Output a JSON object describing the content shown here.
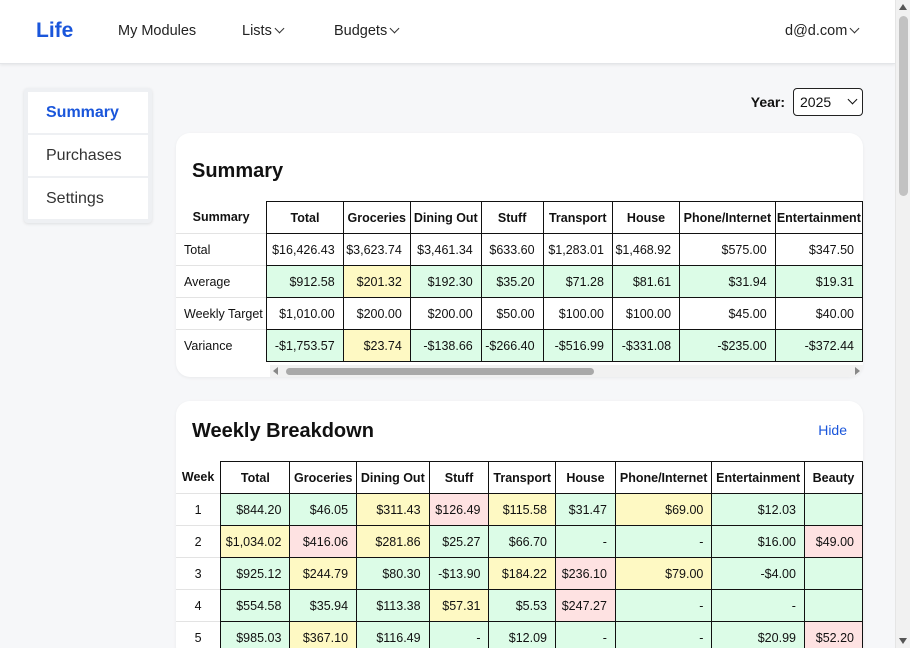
{
  "nav": {
    "brand": "Life",
    "items": [
      {
        "label": "My Modules",
        "dropdown": false
      },
      {
        "label": "Lists",
        "dropdown": true
      },
      {
        "label": "Budgets",
        "dropdown": true
      }
    ],
    "user": "d@d.com"
  },
  "sidebar": {
    "items": [
      {
        "label": "Summary",
        "active": true
      },
      {
        "label": "Purchases",
        "active": false
      },
      {
        "label": "Settings",
        "active": false
      }
    ]
  },
  "year": {
    "label": "Year:",
    "value": "2025"
  },
  "summary": {
    "title": "Summary",
    "corner": "Summary",
    "columns": [
      "Total",
      "Groceries",
      "Dining Out",
      "Stuff",
      "Transport",
      "House",
      "Phone/Internet",
      "Entertainment"
    ],
    "rows": [
      {
        "label": "Total",
        "cells": [
          {
            "v": "$16,426.43",
            "c": "w"
          },
          {
            "v": "$3,623.74",
            "c": "w"
          },
          {
            "v": "$3,461.34",
            "c": "w"
          },
          {
            "v": "$633.60",
            "c": "w"
          },
          {
            "v": "$1,283.01",
            "c": "w"
          },
          {
            "v": "$1,468.92",
            "c": "w"
          },
          {
            "v": "$575.00",
            "c": "w"
          },
          {
            "v": "$347.50",
            "c": "w"
          }
        ]
      },
      {
        "label": "Average",
        "cells": [
          {
            "v": "$912.58",
            "c": "g"
          },
          {
            "v": "$201.32",
            "c": "y"
          },
          {
            "v": "$192.30",
            "c": "g"
          },
          {
            "v": "$35.20",
            "c": "g"
          },
          {
            "v": "$71.28",
            "c": "g"
          },
          {
            "v": "$81.61",
            "c": "g"
          },
          {
            "v": "$31.94",
            "c": "g"
          },
          {
            "v": "$19.31",
            "c": "g"
          }
        ]
      },
      {
        "label": "Weekly Target",
        "cells": [
          {
            "v": "$1,010.00",
            "c": "w"
          },
          {
            "v": "$200.00",
            "c": "w"
          },
          {
            "v": "$200.00",
            "c": "w"
          },
          {
            "v": "$50.00",
            "c": "w"
          },
          {
            "v": "$100.00",
            "c": "w"
          },
          {
            "v": "$100.00",
            "c": "w"
          },
          {
            "v": "$45.00",
            "c": "w"
          },
          {
            "v": "$40.00",
            "c": "w"
          }
        ]
      },
      {
        "label": "Variance",
        "cells": [
          {
            "v": "-$1,753.57",
            "c": "g"
          },
          {
            "v": "$23.74",
            "c": "y"
          },
          {
            "v": "-$138.66",
            "c": "g"
          },
          {
            "v": "-$266.40",
            "c": "g"
          },
          {
            "v": "-$516.99",
            "c": "g"
          },
          {
            "v": "-$331.08",
            "c": "g"
          },
          {
            "v": "-$235.00",
            "c": "g"
          },
          {
            "v": "-$372.44",
            "c": "g"
          }
        ]
      }
    ]
  },
  "weekly": {
    "title": "Weekly Breakdown",
    "hide_label": "Hide",
    "corner": "Week",
    "columns": [
      "Total",
      "Groceries",
      "Dining Out",
      "Stuff",
      "Transport",
      "House",
      "Phone/Internet",
      "Entertainment",
      "Beauty"
    ],
    "rows": [
      {
        "label": "1",
        "cells": [
          {
            "v": "$844.20",
            "c": "g"
          },
          {
            "v": "$46.05",
            "c": "g"
          },
          {
            "v": "$311.43",
            "c": "y"
          },
          {
            "v": "$126.49",
            "c": "r"
          },
          {
            "v": "$115.58",
            "c": "y"
          },
          {
            "v": "$31.47",
            "c": "g"
          },
          {
            "v": "$69.00",
            "c": "y"
          },
          {
            "v": "$12.03",
            "c": "g"
          },
          {
            "v": "",
            "c": "g"
          }
        ]
      },
      {
        "label": "2",
        "cells": [
          {
            "v": "$1,034.02",
            "c": "y"
          },
          {
            "v": "$416.06",
            "c": "r"
          },
          {
            "v": "$281.86",
            "c": "y"
          },
          {
            "v": "$25.27",
            "c": "g"
          },
          {
            "v": "$66.70",
            "c": "g"
          },
          {
            "v": "-",
            "c": "g"
          },
          {
            "v": "-",
            "c": "g"
          },
          {
            "v": "$16.00",
            "c": "g"
          },
          {
            "v": "$49.00",
            "c": "r"
          }
        ]
      },
      {
        "label": "3",
        "cells": [
          {
            "v": "$925.12",
            "c": "g"
          },
          {
            "v": "$244.79",
            "c": "y"
          },
          {
            "v": "$80.30",
            "c": "g"
          },
          {
            "v": "-$13.90",
            "c": "g"
          },
          {
            "v": "$184.22",
            "c": "y"
          },
          {
            "v": "$236.10",
            "c": "r"
          },
          {
            "v": "$79.00",
            "c": "y"
          },
          {
            "v": "-$4.00",
            "c": "g"
          },
          {
            "v": "",
            "c": "g"
          }
        ]
      },
      {
        "label": "4",
        "cells": [
          {
            "v": "$554.58",
            "c": "g"
          },
          {
            "v": "$35.94",
            "c": "g"
          },
          {
            "v": "$113.38",
            "c": "g"
          },
          {
            "v": "$57.31",
            "c": "y"
          },
          {
            "v": "$5.53",
            "c": "g"
          },
          {
            "v": "$247.27",
            "c": "r"
          },
          {
            "v": "-",
            "c": "g"
          },
          {
            "v": "-",
            "c": "g"
          },
          {
            "v": "",
            "c": "g"
          }
        ]
      },
      {
        "label": "5",
        "cells": [
          {
            "v": "$985.03",
            "c": "g"
          },
          {
            "v": "$367.10",
            "c": "y"
          },
          {
            "v": "$116.49",
            "c": "g"
          },
          {
            "v": "-",
            "c": "g"
          },
          {
            "v": "$12.09",
            "c": "g"
          },
          {
            "v": "-",
            "c": "g"
          },
          {
            "v": "-",
            "c": "g"
          },
          {
            "v": "$20.99",
            "c": "g"
          },
          {
            "v": "$52.20",
            "c": "r"
          }
        ]
      }
    ]
  }
}
